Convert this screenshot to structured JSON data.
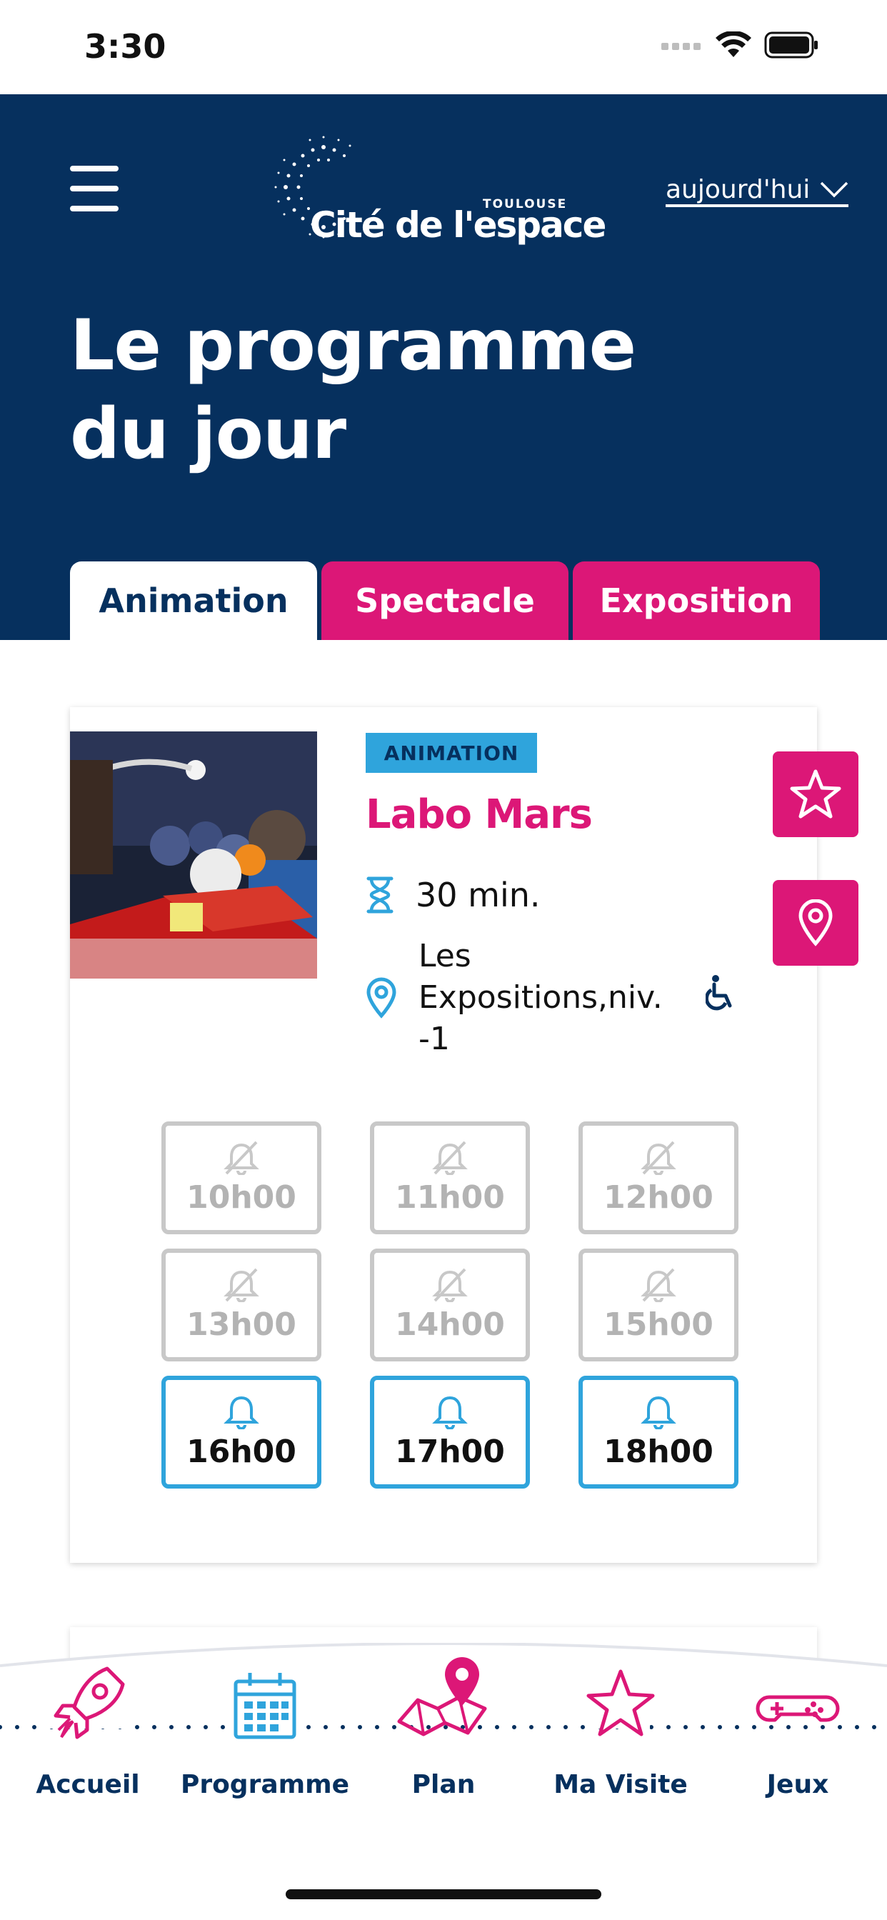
{
  "status_bar": {
    "time": "3:30"
  },
  "header": {
    "logo": {
      "city": "TOULOUSE",
      "name": "Cité de l'espace"
    },
    "date_filter": {
      "label": "aujourd'hui"
    },
    "title_line1": "Le programme",
    "title_line2": "du jour"
  },
  "tabs": [
    {
      "label": "Animation",
      "active": true
    },
    {
      "label": "Spectacle",
      "active": false
    },
    {
      "label": "Exposition",
      "active": false
    }
  ],
  "event": {
    "badge": "ANIMATION",
    "title": "Labo Mars",
    "duration": "30 min.",
    "location_line1": "Les",
    "location_line2": "Expositions,niv.",
    "location_line3": "-1",
    "times": [
      {
        "label": "10h00",
        "available": false
      },
      {
        "label": "11h00",
        "available": false
      },
      {
        "label": "12h00",
        "available": false
      },
      {
        "label": "13h00",
        "available": false
      },
      {
        "label": "14h00",
        "available": false
      },
      {
        "label": "15h00",
        "available": false
      },
      {
        "label": "16h00",
        "available": true
      },
      {
        "label": "17h00",
        "available": true
      },
      {
        "label": "18h00",
        "available": true
      }
    ]
  },
  "bottom_nav": [
    {
      "label": "Accueil",
      "icon": "rocket-icon"
    },
    {
      "label": "Programme",
      "icon": "calendar-icon"
    },
    {
      "label": "Plan",
      "icon": "map-pin-icon"
    },
    {
      "label": "Ma Visite",
      "icon": "star-icon"
    },
    {
      "label": "Jeux",
      "icon": "gamepad-icon"
    }
  ],
  "colors": {
    "navy": "#06305e",
    "magenta": "#dc1777",
    "blue": "#2fa4dc",
    "disabled_gray": "#c8c8c8"
  }
}
